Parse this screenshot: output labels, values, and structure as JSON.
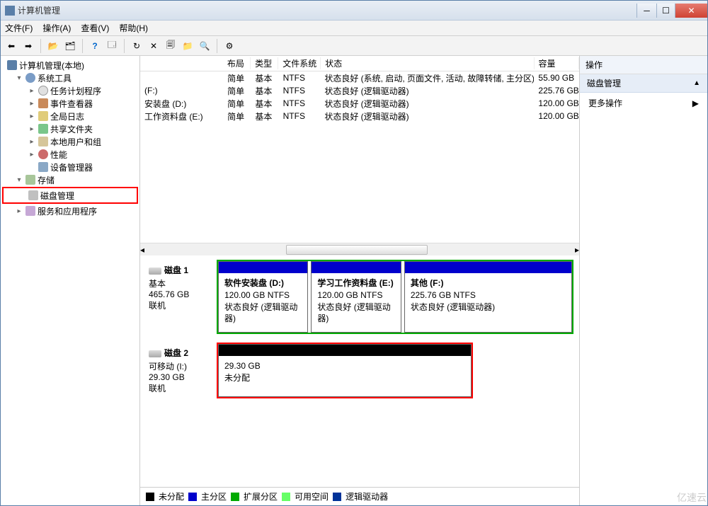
{
  "window": {
    "title": "计算机管理"
  },
  "menu": {
    "file": "文件(F)",
    "action": "操作(A)",
    "view": "查看(V)",
    "help": "帮助(H)"
  },
  "tree": {
    "root": "计算机管理(本地)",
    "systools": "系统工具",
    "task": "任务计划程序",
    "event": "事件查看器",
    "log": "全局日志",
    "share": "共享文件夹",
    "users": "本地用户和组",
    "perf": "性能",
    "device": "设备管理器",
    "storage": "存储",
    "disk": "磁盘管理",
    "services": "服务和应用程序"
  },
  "columns": {
    "vol": "",
    "layout": "布局",
    "type": "类型",
    "fs": "文件系统",
    "status": "状态",
    "cap": "容量"
  },
  "volumes": [
    {
      "name": "",
      "layout": "简单",
      "type": "基本",
      "fs": "NTFS",
      "status": "状态良好 (系统, 启动, 页面文件, 活动, 故障转储, 主分区)",
      "cap": "55.90 GB"
    },
    {
      "name": "(F:)",
      "layout": "简单",
      "type": "基本",
      "fs": "NTFS",
      "status": "状态良好 (逻辑驱动器)",
      "cap": "225.76 GB"
    },
    {
      "name": "安装盘 (D:)",
      "layout": "简单",
      "type": "基本",
      "fs": "NTFS",
      "status": "状态良好 (逻辑驱动器)",
      "cap": "120.00 GB"
    },
    {
      "name": "工作资料盘 (E:)",
      "layout": "简单",
      "type": "基本",
      "fs": "NTFS",
      "status": "状态良好 (逻辑驱动器)",
      "cap": "120.00 GB"
    }
  ],
  "disk1": {
    "label": "磁盘 1",
    "type": "基本",
    "size": "465.76 GB",
    "status": "联机",
    "p1": {
      "name": "软件安装盘  (D:)",
      "info": "120.00 GB NTFS",
      "status": "状态良好 (逻辑驱动器)"
    },
    "p2": {
      "name": "学习工作资料盘  (E:)",
      "info": "120.00 GB NTFS",
      "status": "状态良好 (逻辑驱动器)"
    },
    "p3": {
      "name": "其他  (F:)",
      "info": "225.76 GB NTFS",
      "status": "状态良好 (逻辑驱动器)"
    }
  },
  "disk2": {
    "label": "磁盘 2",
    "type": "可移动 (I:)",
    "size": "29.30 GB",
    "status": "联机",
    "p1": {
      "name": "",
      "info": "29.30 GB",
      "status": "未分配"
    }
  },
  "legend": {
    "unalloc": "未分配",
    "primary": "主分区",
    "extended": "扩展分区",
    "free": "可用空间",
    "logical": "逻辑驱动器"
  },
  "actions": {
    "header": "操作",
    "section": "磁盘管理",
    "more": "更多操作"
  },
  "watermark": "亿速云"
}
